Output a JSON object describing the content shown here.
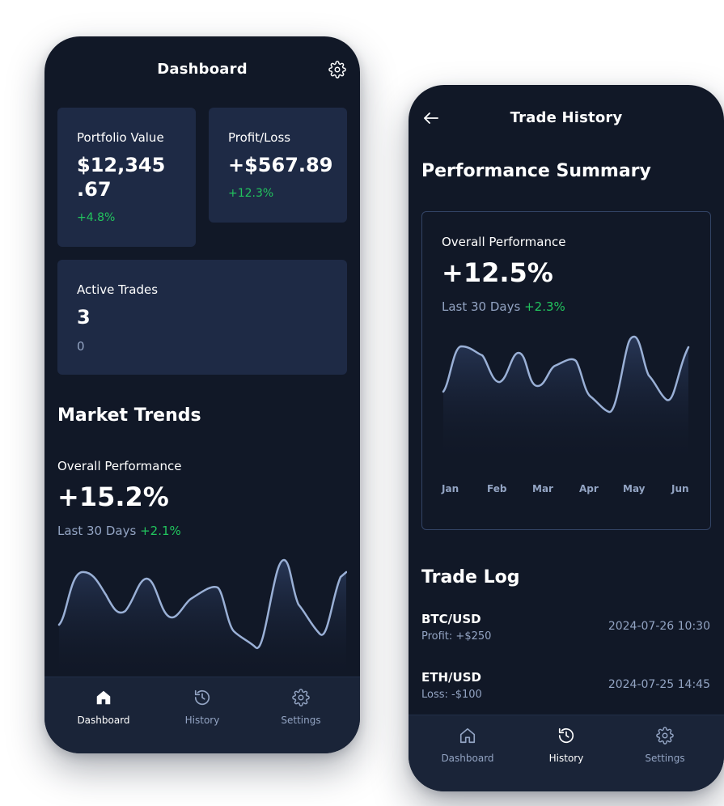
{
  "colors": {
    "background": "#111827",
    "card": "#1e2a45",
    "accent_green": "#22c55e",
    "muted": "#93a4c3",
    "line": "#9ab0d6"
  },
  "dashboard": {
    "title": "Dashboard",
    "settings_icon": "gear-icon",
    "portfolio": {
      "label": "Portfolio Value",
      "value_line1": "$12,345",
      "value_line2": ".67",
      "change": "+4.8%"
    },
    "profit_loss": {
      "label": "Profit/Loss",
      "value": "+$567.89",
      "change": "+12.3%"
    },
    "active_trades": {
      "label": "Active Trades",
      "value": "3",
      "sub": "0"
    },
    "market_trends": {
      "title": "Market Trends",
      "label": "Overall Performance",
      "value": "+15.2%",
      "period": "Last 30 Days",
      "change": "+2.1%"
    },
    "nav": [
      {
        "label": "Dashboard",
        "icon": "home-icon",
        "active": true
      },
      {
        "label": "History",
        "icon": "history-icon",
        "active": false
      },
      {
        "label": "Settings",
        "icon": "gear-icon",
        "active": false
      }
    ]
  },
  "history": {
    "title": "Trade History",
    "back_icon": "arrow-left-icon",
    "summary_title": "Performance Summary",
    "card": {
      "label": "Overall Performance",
      "value": "+12.5%",
      "period": "Last 30 Days",
      "change": "+2.3%",
      "months": [
        "Jan",
        "Feb",
        "Mar",
        "Apr",
        "May",
        "Jun"
      ]
    },
    "trade_log_title": "Trade Log",
    "trades": [
      {
        "pair": "BTC/USD",
        "detail": "Profit: +$250",
        "time": "2024-07-26 10:30"
      },
      {
        "pair": "ETH/USD",
        "detail": "Loss: -$100",
        "time": "2024-07-25 14:45"
      }
    ],
    "nav": [
      {
        "label": "Dashboard",
        "icon": "home-icon",
        "active": false
      },
      {
        "label": "History",
        "icon": "history-icon",
        "active": true
      },
      {
        "label": "Settings",
        "icon": "gear-icon",
        "active": false
      }
    ]
  }
}
